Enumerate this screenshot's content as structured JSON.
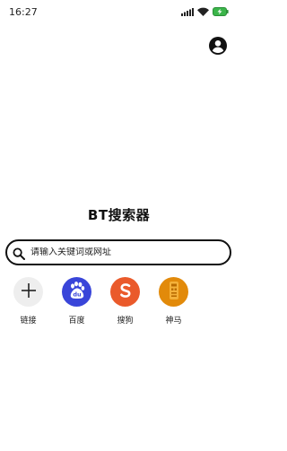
{
  "status_bar": {
    "time": "16:27",
    "icons": [
      "signal-icon",
      "wifi-icon",
      "battery-charging-icon"
    ]
  },
  "header": {
    "account_icon": "account-circle-icon"
  },
  "main": {
    "title": "BT搜索器",
    "search": {
      "placeholder": "请输入关键词或网址",
      "value": ""
    },
    "shortcuts": [
      {
        "label": "链接",
        "icon": "plus-icon",
        "color": "#eeeeee"
      },
      {
        "label": "百度",
        "icon": "baidu-paw-icon",
        "color": "#3945d9"
      },
      {
        "label": "搜狗",
        "icon": "sogou-s-icon",
        "color": "#ea5a2b"
      },
      {
        "label": "神马",
        "icon": "shenma-icon",
        "color": "#e28a0a"
      }
    ]
  }
}
